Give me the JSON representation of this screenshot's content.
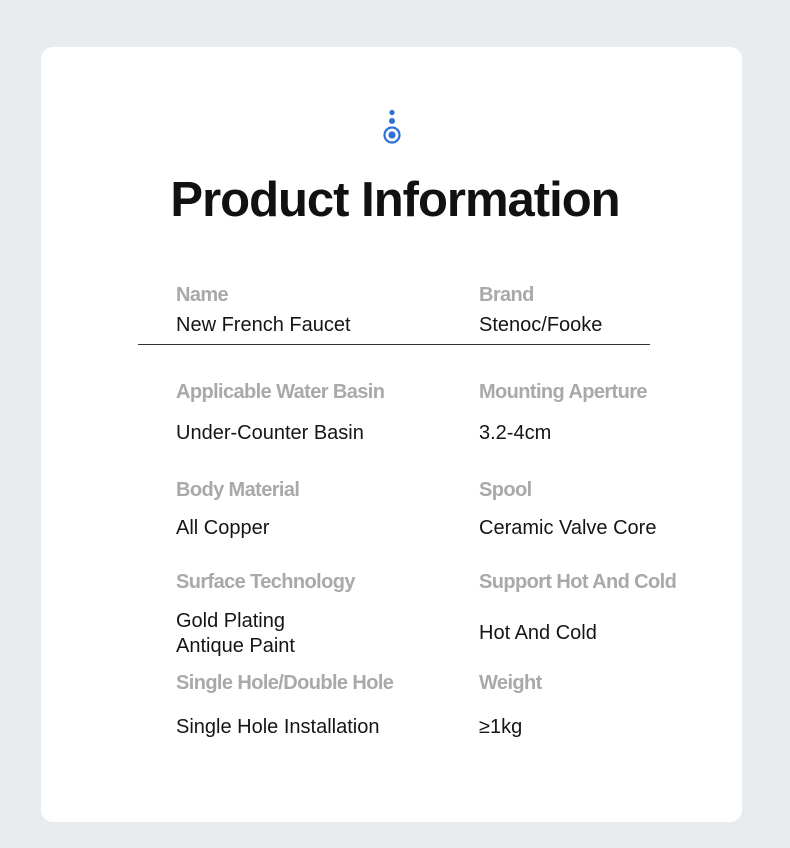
{
  "header": {
    "title": "Product Information",
    "accent_color": "#2f6fd6",
    "logo_icon": "water-drop-dot-icon"
  },
  "specs": [
    {
      "label": "Name",
      "value": [
        "New French Faucet"
      ]
    },
    {
      "label": "Brand",
      "value": [
        "Stenoc/Fooke"
      ]
    },
    {
      "label": "Applicable Water Basin",
      "value": [
        "Under-Counter Basin"
      ]
    },
    {
      "label": "Mounting Aperture",
      "value": [
        "3.2-4cm"
      ]
    },
    {
      "label": "Body Material",
      "value": [
        "All Copper"
      ]
    },
    {
      "label": "Spool",
      "value": [
        "Ceramic Valve Core"
      ]
    },
    {
      "label": "Surface Technology",
      "value": [
        "Gold Plating",
        "Antique Paint"
      ]
    },
    {
      "label": "Support Hot And Cold",
      "value": [
        "Hot And Cold"
      ]
    },
    {
      "label": "Single Hole/Double Hole",
      "value": [
        "Single Hole Installation"
      ]
    },
    {
      "label": "Weight",
      "value": [
        "≥1kg"
      ]
    }
  ]
}
